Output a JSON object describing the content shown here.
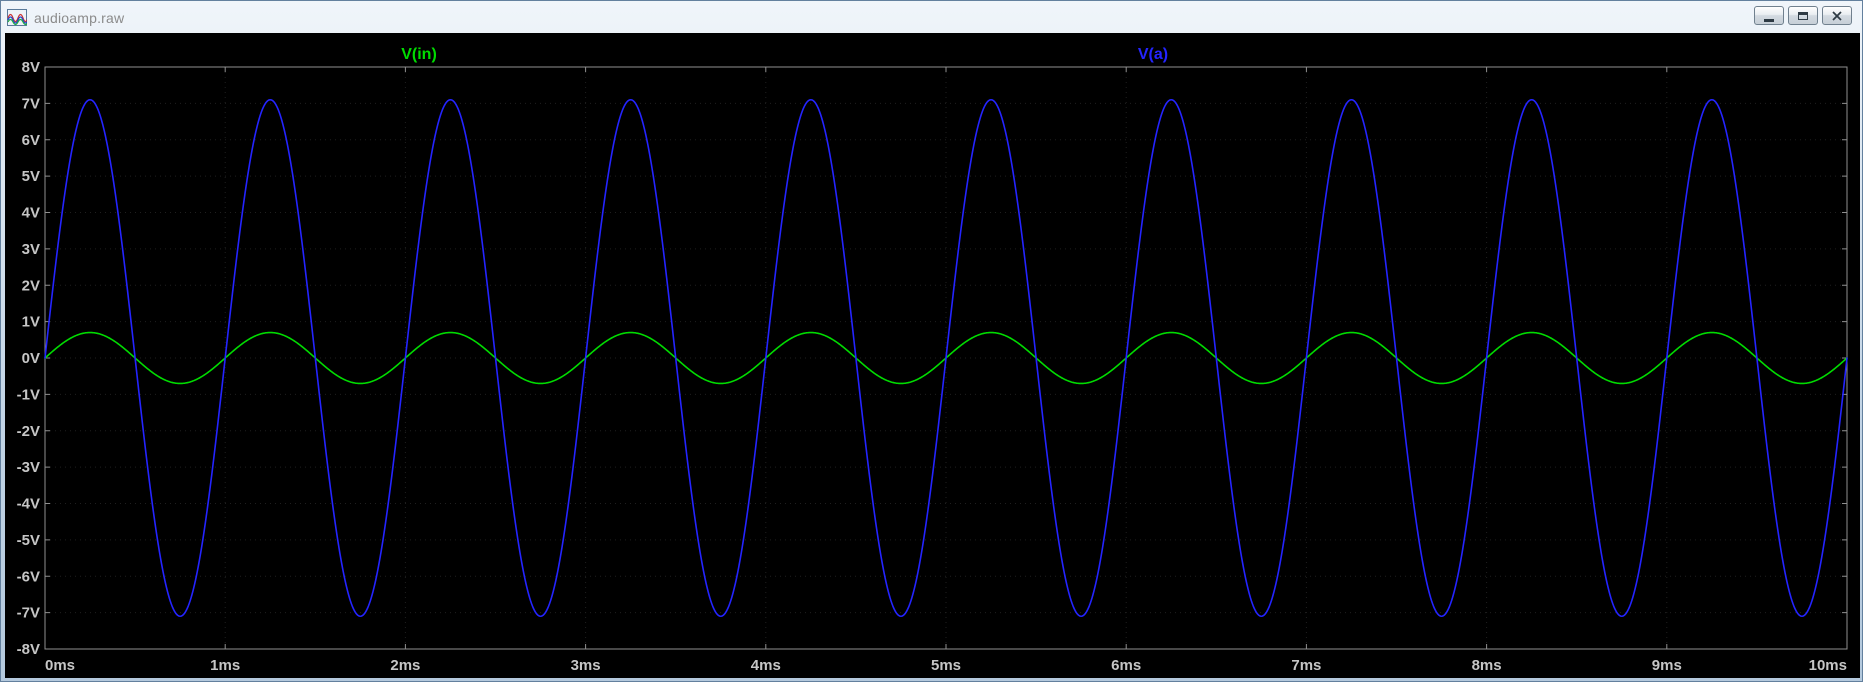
{
  "window": {
    "title": "audioamp.raw",
    "controls": [
      {
        "name": "minimize"
      },
      {
        "name": "maximize"
      },
      {
        "name": "close"
      }
    ]
  },
  "colors": {
    "plot_background": "#000000",
    "axis": "#909090",
    "tick_text": "#c6c6c6",
    "grid": "#1f1f1f",
    "trace_green": "#00dc00",
    "trace_blue": "#2424ff"
  },
  "chart_data": {
    "type": "line",
    "title": "",
    "xlabel": "",
    "ylabel": "",
    "x_unit": "ms",
    "y_unit": "V",
    "x_range_ms": [
      0,
      10
    ],
    "y_range_v": [
      -8,
      8
    ],
    "grid": true,
    "legend_position": "top",
    "x_tick_labels": [
      "0ms",
      "1ms",
      "2ms",
      "3ms",
      "4ms",
      "5ms",
      "6ms",
      "7ms",
      "8ms",
      "9ms",
      "10ms"
    ],
    "y_tick_labels": [
      "8V",
      "7V",
      "6V",
      "5V",
      "4V",
      "3V",
      "2V",
      "1V",
      "0V",
      "-1V",
      "-2V",
      "-3V",
      "-4V",
      "-5V",
      "-6V",
      "-7V",
      "-8V"
    ],
    "series": [
      {
        "name": "V(in)",
        "color": "#00dc00",
        "waveform": "sine",
        "amplitude_v": 0.7,
        "frequency_hz": 1000,
        "phase_deg": 0,
        "offset_v": 0,
        "label_x_frac": 0.223
      },
      {
        "name": "V(a)",
        "color": "#2424ff",
        "waveform": "sine",
        "amplitude_v": 7.1,
        "frequency_hz": 1000,
        "phase_deg": 0,
        "offset_v": 0,
        "label_x_frac": 0.619
      }
    ]
  }
}
